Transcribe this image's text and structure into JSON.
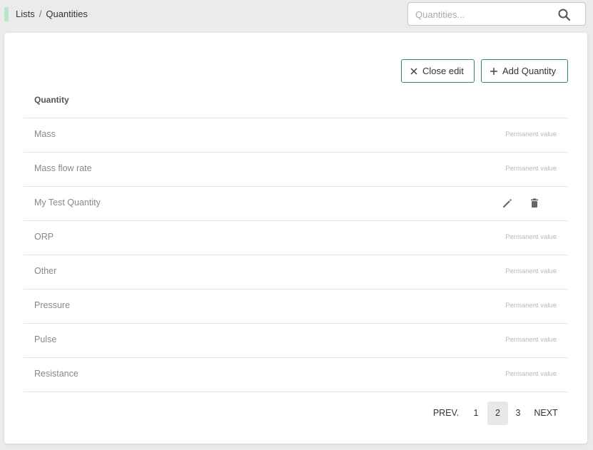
{
  "breadcrumb": {
    "root": "Lists",
    "separator": "/",
    "current": "Quantities"
  },
  "search": {
    "placeholder": "Quantities...",
    "value": ""
  },
  "toolbar": {
    "close_edit_label": "Close edit",
    "add_label": "Add Quantity"
  },
  "table": {
    "header": "Quantity",
    "rows": [
      {
        "name": "Mass",
        "status": "Permanent value"
      },
      {
        "name": "Mass flow rate",
        "status": "Permanent value"
      },
      {
        "name": "My Test Quantity",
        "status": ""
      },
      {
        "name": "ORP",
        "status": "Permanent value"
      },
      {
        "name": "Other",
        "status": "Permanent value"
      },
      {
        "name": "Pressure",
        "status": "Permanent value"
      },
      {
        "name": "Pulse",
        "status": "Permanent value"
      },
      {
        "name": "Resistance",
        "status": "Permanent value"
      }
    ]
  },
  "pagination": {
    "prev": "PREV.",
    "pages": [
      "1",
      "2",
      "3"
    ],
    "current": "2",
    "next": "NEXT"
  },
  "colors": {
    "accent": "#2e8b5a",
    "accent_light": "#b9e6c8"
  },
  "icons": {
    "search": "search-icon",
    "close": "close-icon",
    "add": "plus-icon",
    "edit": "pencil-icon",
    "delete": "trash-icon"
  }
}
